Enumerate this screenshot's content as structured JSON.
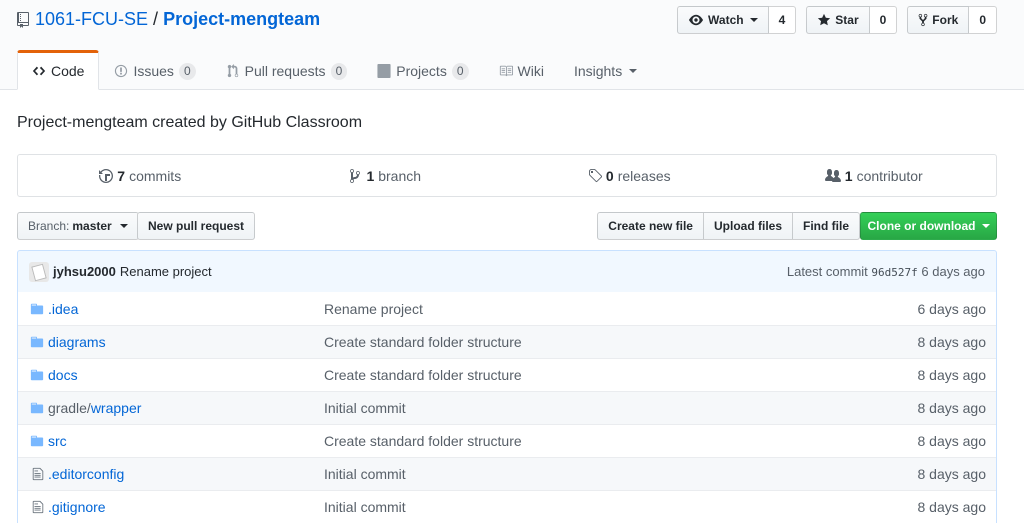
{
  "repo": {
    "owner": "1061-FCU-SE",
    "separator": "/",
    "name": "Project-mengteam"
  },
  "actions": {
    "watch_label": "Watch",
    "watch_count": "4",
    "star_label": "Star",
    "star_count": "0",
    "fork_label": "Fork",
    "fork_count": "0"
  },
  "tabs": [
    {
      "label": "Code",
      "selected": true
    },
    {
      "label": "Issues",
      "counter": "0"
    },
    {
      "label": "Pull requests",
      "counter": "0"
    },
    {
      "label": "Projects",
      "counter": "0"
    },
    {
      "label": "Wiki"
    },
    {
      "label": "Insights"
    }
  ],
  "description": "Project-mengteam created by GitHub Classroom",
  "summary": {
    "commits_num": "7",
    "commits_label": "commits",
    "branch_num": "1",
    "branch_label": "branch",
    "releases_num": "0",
    "releases_label": "releases",
    "contributor_num": "1",
    "contributor_label": "contributor"
  },
  "filebar": {
    "branch_label": "Branch:",
    "branch_value": "master",
    "new_pr": "New pull request",
    "create_file": "Create new file",
    "upload_files": "Upload files",
    "find_file": "Find file",
    "clone": "Clone or download"
  },
  "latest_commit": {
    "author": "jyhsu2000",
    "message": "Rename project",
    "prefix": "Latest commit",
    "sha": "96d527f",
    "age": "6 days ago"
  },
  "files": [
    {
      "type": "dir",
      "name": ".idea",
      "message": "Rename project",
      "age": "6 days ago"
    },
    {
      "type": "dir",
      "name": "diagrams",
      "message": "Create standard folder structure",
      "age": "8 days ago"
    },
    {
      "type": "dir",
      "name": "docs",
      "message": "Create standard folder structure",
      "age": "8 days ago"
    },
    {
      "type": "dir",
      "name_prefix": "gradle/",
      "name": "wrapper",
      "message": "Initial commit",
      "age": "8 days ago"
    },
    {
      "type": "dir",
      "name": "src",
      "message": "Create standard folder structure",
      "age": "8 days ago"
    },
    {
      "type": "file",
      "name": ".editorconfig",
      "message": "Initial commit",
      "age": "8 days ago"
    },
    {
      "type": "file",
      "name": ".gitignore",
      "message": "Initial commit",
      "age": "8 days ago"
    }
  ],
  "colors": {
    "link": "#0366d6",
    "folder": "#79b8ff",
    "selected_tab_accent": "#e36209",
    "clone_green": "#28a745"
  }
}
